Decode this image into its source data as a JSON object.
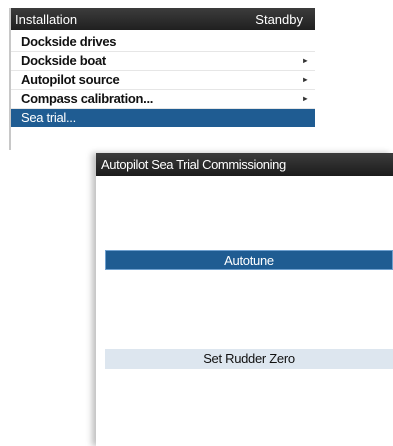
{
  "installation_menu": {
    "title": "Installation",
    "status": "Standby",
    "items": [
      {
        "label": "Dockside drives",
        "arrow": ""
      },
      {
        "label": "Dockside boat",
        "arrow": "▸"
      },
      {
        "label": "Autopilot source",
        "arrow": "▸"
      },
      {
        "label": "Compass calibration...",
        "arrow": "▸"
      },
      {
        "label": "Sea trial...",
        "arrow": ""
      }
    ],
    "selected_index": 4
  },
  "sea_trial_dialog": {
    "title": "Autopilot Sea Trial Commissioning",
    "autotune_label": "Autotune",
    "rudder_zero_label": "Set Rudder Zero"
  },
  "colors": {
    "selection_blue": "#1f5c92",
    "header_dark": "#2a2a2a",
    "button_light": "#dde6ef"
  }
}
